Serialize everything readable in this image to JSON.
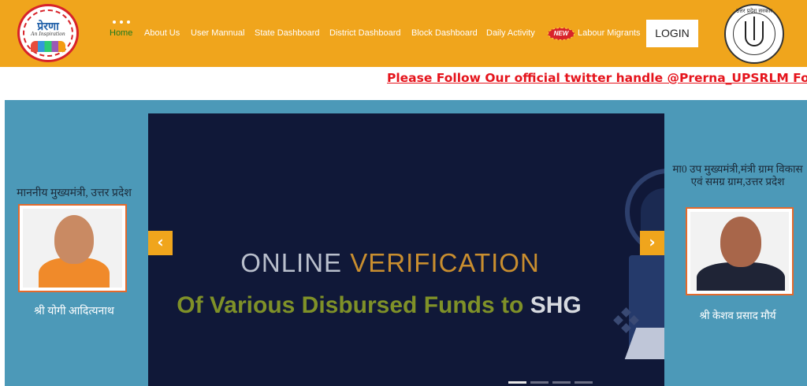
{
  "header": {
    "logo_left": {
      "brand": "प्रेरणा",
      "tagline": "An Inspiration"
    },
    "nav": [
      {
        "label": "Home",
        "active": true
      },
      {
        "label": "About Us"
      },
      {
        "label": "User Mannual"
      },
      {
        "label": "State Dashboard"
      },
      {
        "label": "District Dashboard"
      },
      {
        "label": "Block Dashboard"
      },
      {
        "label": "Daily Activity"
      },
      {
        "label": "Labour Migrants",
        "badge": "NEW"
      }
    ],
    "login_label": "LOGIN",
    "logo_right": {
      "text": "उत्तर प्रदेश सरकार"
    }
  },
  "marquee": {
    "text": "Please Follow Our official twitter handle @Prerna_UPSRLM For Dail"
  },
  "leaders": {
    "left": {
      "title": "माननीय मुख्यमंत्री, उत्तर प्रदेश",
      "name": "श्री योगी आदित्यनाथ"
    },
    "right": {
      "title": "मा0 उप मुख्यमंत्री,मंत्री ग्राम विकास एवं समग्र ग्राम,उत्तर प्रदेश",
      "name": "श्री केशव प्रसाद मौर्य"
    }
  },
  "carousel": {
    "headline_word1": "ONLINE",
    "headline_word2": "VERIFICATION",
    "subline_part1": "Of Various Disbursed Funds to",
    "subline_part2": "SHG",
    "prev_icon": "‹",
    "next_icon": "›",
    "slide_count": 4,
    "active_slide": 1
  },
  "colors": {
    "header_bg": "#f0a51c",
    "marquee_text": "#e5141c",
    "main_bg": "#4c99b8",
    "carousel_bg": "#101838",
    "nav_active": "#1e7a1e"
  }
}
